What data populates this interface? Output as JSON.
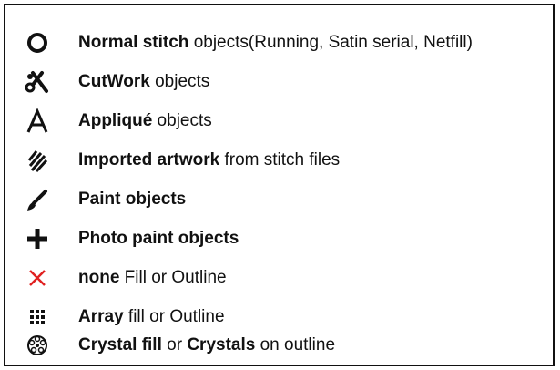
{
  "legend": {
    "items": [
      {
        "icon": "circle-outline-icon",
        "bold": "Normal stitch",
        "text": " objects(Running, Satin serial, Netfill)"
      },
      {
        "icon": "scissors-icon",
        "bold": "CutWork",
        "text": " objects"
      },
      {
        "icon": "letter-a-icon",
        "bold": "Appliqué",
        "text": " objects"
      },
      {
        "icon": "hatched-artwork-icon",
        "bold": "Imported artwork",
        "text": " from stitch files"
      },
      {
        "icon": "paint-brush-icon",
        "bold": "Paint objects",
        "text": ""
      },
      {
        "icon": "plus-icon",
        "bold": "Photo paint objects",
        "text": ""
      },
      {
        "icon": "red-x-icon",
        "bold": "none",
        "text": " Fill or Outline"
      },
      {
        "icon": "dot-grid-icon",
        "bold": "Array",
        "text": " fill or Outline"
      },
      {
        "icon": "crystal-icon",
        "bold": "Crystal fill",
        "text": " or ",
        "bold2": "Crystals",
        "text2": " on outline"
      }
    ]
  },
  "colors": {
    "text": "#111111",
    "icon": "#111111",
    "none_icon": "#e02020",
    "border": "#111111"
  }
}
